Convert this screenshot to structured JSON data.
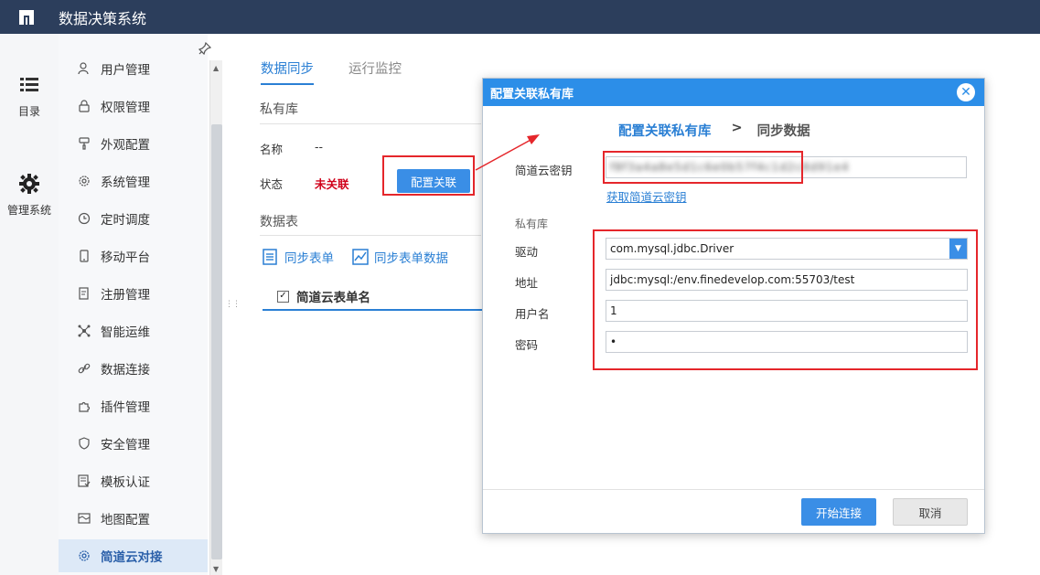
{
  "app": {
    "title": "数据决策系统"
  },
  "rail": [
    {
      "label": "目录",
      "icon": "list-icon"
    },
    {
      "label": "管理系统",
      "icon": "gear-icon"
    }
  ],
  "subnav": [
    {
      "label": "用户管理",
      "icon": "user-icon"
    },
    {
      "label": "权限管理",
      "icon": "lock-icon"
    },
    {
      "label": "外观配置",
      "icon": "brush-icon"
    },
    {
      "label": "系统管理",
      "icon": "gear-icon"
    },
    {
      "label": "定时调度",
      "icon": "clock-icon"
    },
    {
      "label": "移动平台",
      "icon": "phone-icon"
    },
    {
      "label": "注册管理",
      "icon": "register-icon"
    },
    {
      "label": "智能运维",
      "icon": "network-icon"
    },
    {
      "label": "数据连接",
      "icon": "link-icon"
    },
    {
      "label": "插件管理",
      "icon": "puzzle-icon"
    },
    {
      "label": "安全管理",
      "icon": "shield-icon"
    },
    {
      "label": "模板认证",
      "icon": "template-icon"
    },
    {
      "label": "地图配置",
      "icon": "map-icon"
    },
    {
      "label": "简道云对接",
      "icon": "gear-icon"
    }
  ],
  "main": {
    "tabs": [
      {
        "label": "数据同步"
      },
      {
        "label": "运行监控"
      }
    ],
    "private_title": "私有库",
    "name_label": "名称",
    "name_value": "--",
    "status_label": "状态",
    "status_value": "未关联",
    "config_button": "配置关联",
    "tables_title": "数据表",
    "tool_sync": "同步表单",
    "tool_sync_data": "同步表单数据",
    "column_header": "简道云表单名"
  },
  "dialog": {
    "title": "配置关联私有库",
    "step1": "配置关联私有库",
    "step_sep": ">",
    "step2": "同步数据",
    "key_label": "简道云密钥",
    "key_value": "f8f3a4a8e5d1c6e0b57f4c1d2c8d91e4",
    "get_key_link": "获取简道云密钥",
    "group_label": "私有库",
    "driver_label": "驱动",
    "driver_value": "com.mysql.jdbc.Driver",
    "url_label": "地址",
    "url_value": "jdbc:mysql:/env.finedevelop.com:55703/test",
    "user_label": "用户名",
    "user_value": "1",
    "pwd_label": "密码",
    "pwd_value": "•",
    "start_button": "开始连接",
    "cancel_button": "取消"
  },
  "colors": {
    "topbar": "#2c3e5c",
    "accent": "#2a7fd4",
    "button": "#3a8ee6",
    "highlight": "#e5262b",
    "status_off": "#d0021b"
  }
}
